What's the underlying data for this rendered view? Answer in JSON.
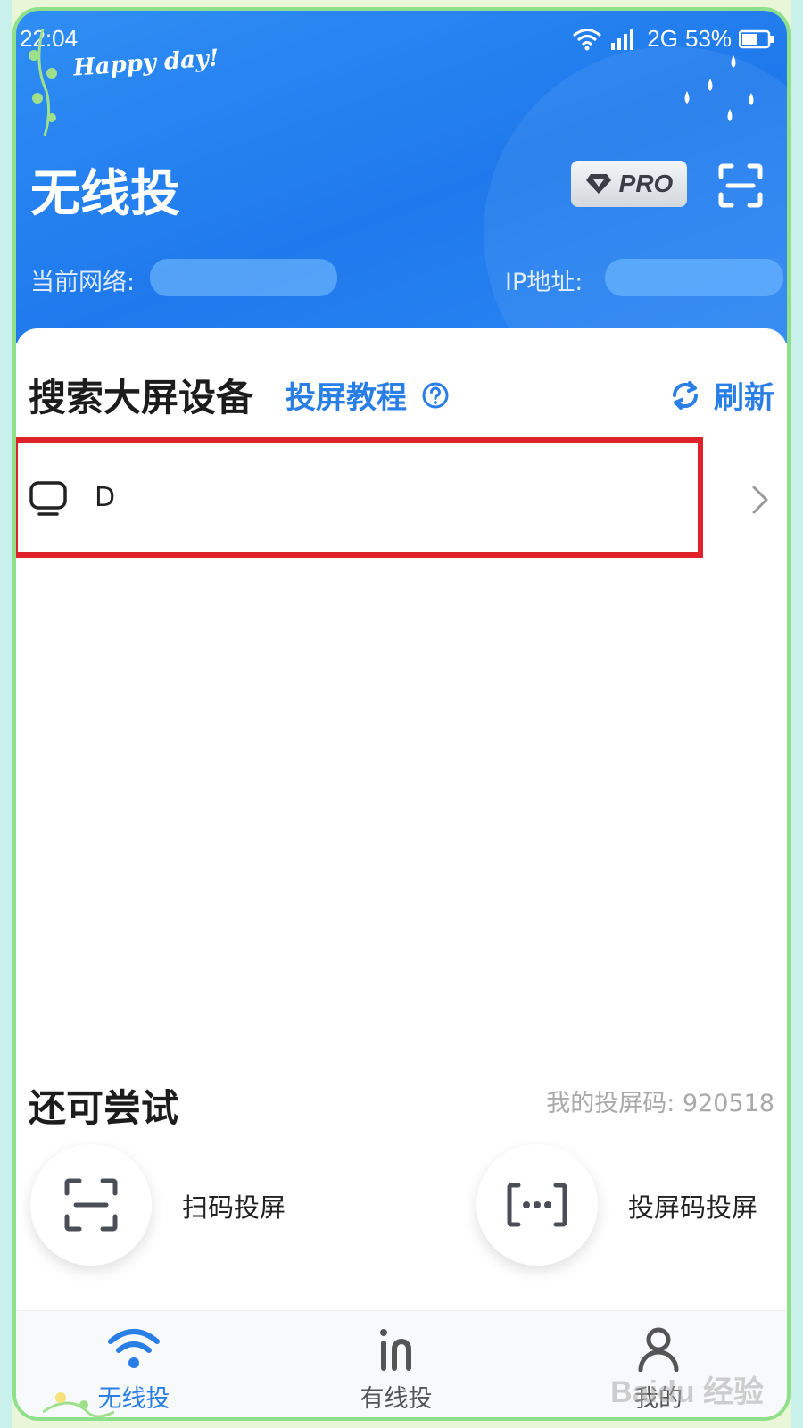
{
  "status_bar": {
    "time": "22:04",
    "network": "2G",
    "battery": "53%"
  },
  "decor": {
    "greeting": "Happy day!"
  },
  "header": {
    "title": "无线投",
    "pro_label": "PRO",
    "network_label": "当前网络: ",
    "ip_label": "IP地址: "
  },
  "devices": {
    "section_title": "搜索大屏设备",
    "tutorial_label": "投屏教程",
    "refresh_label": "刷新",
    "items": [
      {
        "name": "D"
      }
    ]
  },
  "try_more": {
    "title": "还可尝试",
    "cast_code_label": "我的投屏码: 920518",
    "options": [
      {
        "label": "扫码投屏"
      },
      {
        "label": "投屏码投屏"
      }
    ]
  },
  "bottom_nav": {
    "items": [
      {
        "label": "无线投",
        "active": true
      },
      {
        "label": "有线投",
        "active": false
      },
      {
        "label": "我的",
        "active": false
      }
    ]
  },
  "watermark": "Baidu 经验",
  "colors": {
    "primary": "#2a7fe6",
    "header_bg": "#1f79ec",
    "highlight_border": "#e0232b",
    "inactive": "#555555"
  }
}
